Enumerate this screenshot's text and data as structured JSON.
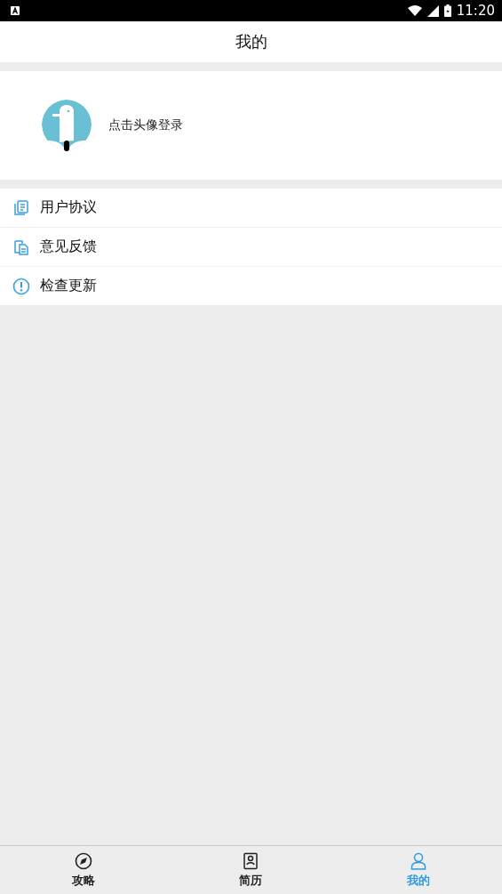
{
  "status_bar": {
    "time": "11:20"
  },
  "header": {
    "title": "我的"
  },
  "profile": {
    "login_hint": "点击头像登录"
  },
  "menu": [
    {
      "label": "用户协议"
    },
    {
      "label": "意见反馈"
    },
    {
      "label": "检查更新"
    }
  ],
  "tabs": [
    {
      "label": "攻略",
      "selected": false
    },
    {
      "label": "简历",
      "selected": false
    },
    {
      "label": "我的",
      "selected": true
    }
  ]
}
